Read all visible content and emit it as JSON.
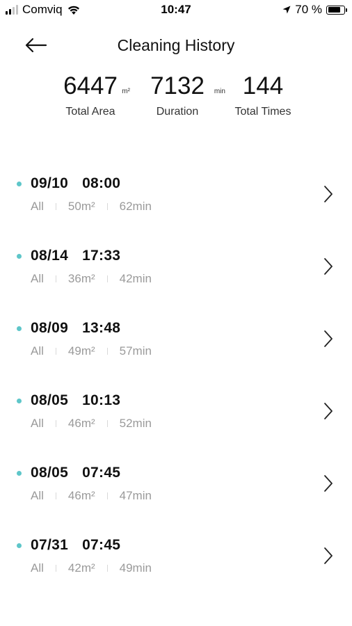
{
  "status_bar": {
    "carrier": "Comviq",
    "time": "10:47",
    "battery_percent": "70 %"
  },
  "header": {
    "title": "Cleaning History"
  },
  "stats": {
    "area_value": "6447",
    "area_unit": "m²",
    "area_label": "Total Area",
    "duration_value": "7132",
    "duration_unit": "min",
    "duration_label": "Duration",
    "times_value": "144",
    "times_label": "Total Times"
  },
  "records": [
    {
      "date": "09/10",
      "time": "08:00",
      "mode": "All",
      "area": "50m²",
      "duration": "62min"
    },
    {
      "date": "08/14",
      "time": "17:33",
      "mode": "All",
      "area": "36m²",
      "duration": "42min"
    },
    {
      "date": "08/09",
      "time": "13:48",
      "mode": "All",
      "area": "49m²",
      "duration": "57min"
    },
    {
      "date": "08/05",
      "time": "10:13",
      "mode": "All",
      "area": "46m²",
      "duration": "52min"
    },
    {
      "date": "08/05",
      "time": "07:45",
      "mode": "All",
      "area": "46m²",
      "duration": "47min"
    },
    {
      "date": "07/31",
      "time": "07:45",
      "mode": "All",
      "area": "42m²",
      "duration": "49min"
    }
  ],
  "colors": {
    "accent_dot": "#5ec6c9",
    "secondary_text": "#9a9a9a"
  }
}
